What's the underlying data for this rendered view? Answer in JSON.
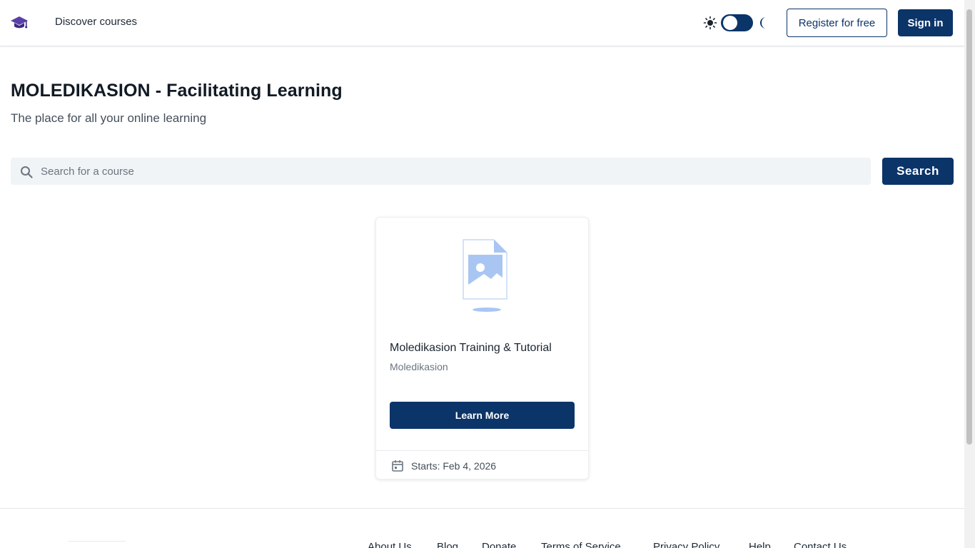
{
  "header": {
    "nav_link": "Discover courses",
    "register_label": "Register for free",
    "signin_label": "Sign in"
  },
  "hero": {
    "title": "MOLEDIKASION - Facilitating Learning",
    "subtitle": "The place for all your online learning"
  },
  "search": {
    "placeholder": "Search for a course",
    "value": "",
    "button_label": "Search"
  },
  "courses": [
    {
      "title": "Moledikasion Training & Tutorial",
      "org": "Moledikasion",
      "button_label": "Learn More",
      "start_text": "Starts: Feb 4, 2026"
    }
  ],
  "footer": {
    "links": [
      "About Us",
      "Blog",
      "Donate",
      "Terms of Service",
      "Privacy Policy",
      "Help",
      "Contact Us"
    ]
  },
  "colors": {
    "primary": "#0b3468",
    "logo": "#5b3fa8",
    "image_placeholder": "#a9c6f3"
  },
  "icons": {
    "logo": "graduation-cap-icon",
    "light_mode": "sun-icon",
    "dark_mode": "moon-icon",
    "search": "search-icon",
    "course_image": "image-placeholder-icon",
    "start_date": "calendar-icon"
  },
  "theme": {
    "dark_mode_enabled": false
  }
}
